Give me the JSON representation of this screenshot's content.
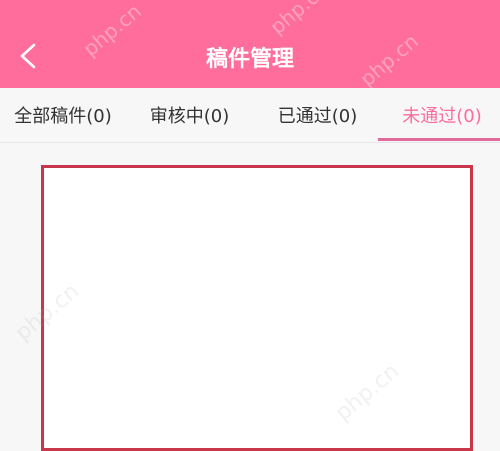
{
  "header": {
    "title": "稿件管理",
    "watermark_text": "php.cn"
  },
  "tabs": [
    {
      "label": "全部稿件(0)"
    },
    {
      "label": "审核中(0)"
    },
    {
      "label": "已通过(0)"
    },
    {
      "label": "未通过(0)"
    }
  ],
  "colors": {
    "header_bg": "#fe6d9c",
    "active_tab": "#fe6d9c",
    "box_border": "#c8374a"
  }
}
